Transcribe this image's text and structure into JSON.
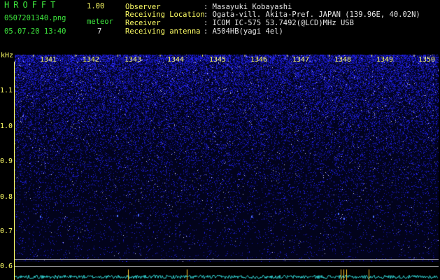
{
  "header": {
    "app_name": "HROFFT",
    "version": "1.00",
    "filename": "0507201340.png",
    "meteor_label": "meteor",
    "meteor_count": "7",
    "datetime": "05.07.20 13:40"
  },
  "info": [
    {
      "key": "Observer",
      "value": ": Masayuki Kobayashi"
    },
    {
      "key": "Receiving Location",
      "value": ": Ogata-vill. Akita-Pref. JAPAN (139.96E, 40.02N)"
    },
    {
      "key": "Receiver",
      "value": ": ICOM IC-575 53.7492(@LCD)MHz USB"
    },
    {
      "key": "Receiving antenna",
      "value": ": A504HB(yagi 4el)"
    }
  ],
  "axis": {
    "unit": "kHz",
    "minutes": [
      "1341",
      "1342",
      "1343",
      "1344",
      "1345",
      "1346",
      "1347",
      "1348",
      "1349",
      "1350"
    ],
    "freqs": [
      "1.1",
      "1.0",
      "0.9",
      "0.8",
      "0.7",
      "0.6"
    ]
  },
  "colors": {
    "background": "#000000",
    "label_green": "#3ee83e",
    "label_yellow": "#ffff66",
    "noise": "#3b3bd8",
    "trace": "#30d0d0"
  }
}
